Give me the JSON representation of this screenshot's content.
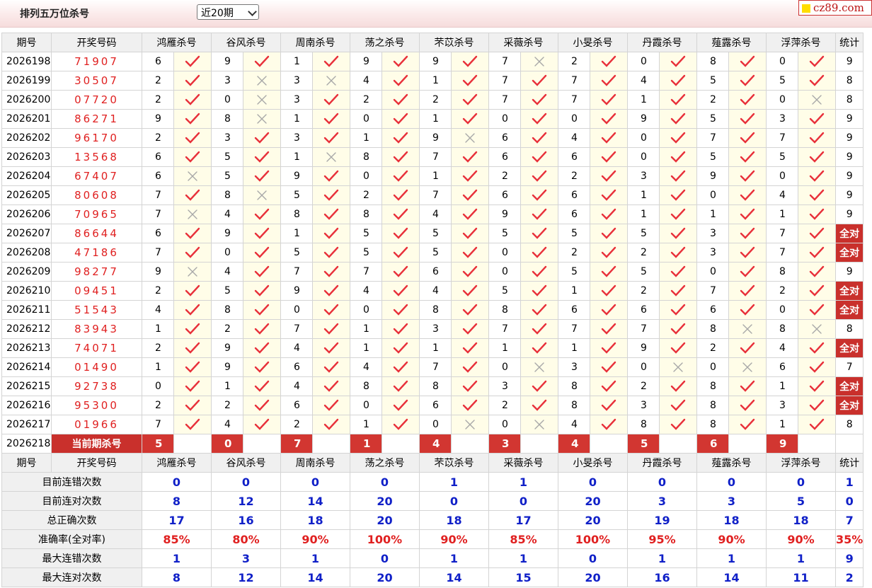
{
  "page_title": "排列五万位杀号",
  "period_select": {
    "value": "近20期"
  },
  "logo_text": "cz89.com",
  "headers": [
    "期号",
    "开奖号码",
    "鸿雁杀号",
    "谷风杀号",
    "周南杀号",
    "荡之杀号",
    "芣苡杀号",
    "采薇杀号",
    "小旻杀号",
    "丹霞杀号",
    "薤露杀号",
    "浮萍杀号",
    "统计"
  ],
  "rows": [
    {
      "issue": "2026198",
      "draw": "71907",
      "kills": [
        6,
        9,
        1,
        9,
        9,
        7,
        2,
        0,
        8,
        0
      ],
      "ok": [
        1,
        1,
        1,
        1,
        1,
        0,
        1,
        1,
        1,
        1
      ],
      "stat": "9"
    },
    {
      "issue": "2026199",
      "draw": "30507",
      "kills": [
        2,
        3,
        3,
        4,
        1,
        7,
        7,
        4,
        5,
        5
      ],
      "ok": [
        1,
        0,
        0,
        1,
        1,
        1,
        1,
        1,
        1,
        1
      ],
      "stat": "8"
    },
    {
      "issue": "2026200",
      "draw": "07720",
      "kills": [
        2,
        0,
        3,
        2,
        2,
        7,
        7,
        1,
        2,
        0
      ],
      "ok": [
        1,
        0,
        1,
        1,
        1,
        1,
        1,
        1,
        1,
        0
      ],
      "stat": "8"
    },
    {
      "issue": "2026201",
      "draw": "86271",
      "kills": [
        9,
        8,
        1,
        0,
        1,
        0,
        0,
        9,
        5,
        3
      ],
      "ok": [
        1,
        0,
        1,
        1,
        1,
        1,
        1,
        1,
        1,
        1
      ],
      "stat": "9"
    },
    {
      "issue": "2026202",
      "draw": "96170",
      "kills": [
        2,
        3,
        3,
        1,
        9,
        6,
        4,
        0,
        7,
        7
      ],
      "ok": [
        1,
        1,
        1,
        1,
        0,
        1,
        1,
        1,
        1,
        1
      ],
      "stat": "9"
    },
    {
      "issue": "2026203",
      "draw": "13568",
      "kills": [
        6,
        5,
        1,
        8,
        7,
        6,
        6,
        0,
        5,
        5
      ],
      "ok": [
        1,
        1,
        0,
        1,
        1,
        1,
        1,
        1,
        1,
        1
      ],
      "stat": "9"
    },
    {
      "issue": "2026204",
      "draw": "67407",
      "kills": [
        6,
        5,
        9,
        0,
        1,
        2,
        2,
        3,
        9,
        0
      ],
      "ok": [
        0,
        1,
        1,
        1,
        1,
        1,
        1,
        1,
        1,
        1
      ],
      "stat": "9"
    },
    {
      "issue": "2026205",
      "draw": "80608",
      "kills": [
        7,
        8,
        5,
        2,
        7,
        6,
        6,
        1,
        0,
        4
      ],
      "ok": [
        1,
        0,
        1,
        1,
        1,
        1,
        1,
        1,
        1,
        1
      ],
      "stat": "9"
    },
    {
      "issue": "2026206",
      "draw": "70965",
      "kills": [
        7,
        4,
        8,
        8,
        4,
        9,
        6,
        1,
        1,
        1
      ],
      "ok": [
        0,
        1,
        1,
        1,
        1,
        1,
        1,
        1,
        1,
        1
      ],
      "stat": "9"
    },
    {
      "issue": "2026207",
      "draw": "86644",
      "kills": [
        6,
        9,
        1,
        5,
        5,
        5,
        5,
        5,
        3,
        7
      ],
      "ok": [
        1,
        1,
        1,
        1,
        1,
        1,
        1,
        1,
        1,
        1
      ],
      "stat": "全对"
    },
    {
      "issue": "2026208",
      "draw": "47186",
      "kills": [
        7,
        0,
        5,
        5,
        5,
        0,
        2,
        2,
        3,
        7
      ],
      "ok": [
        1,
        1,
        1,
        1,
        1,
        1,
        1,
        1,
        1,
        1
      ],
      "stat": "全对"
    },
    {
      "issue": "2026209",
      "draw": "98277",
      "kills": [
        9,
        4,
        7,
        7,
        6,
        0,
        5,
        5,
        0,
        8
      ],
      "ok": [
        0,
        1,
        1,
        1,
        1,
        1,
        1,
        1,
        1,
        1
      ],
      "stat": "9"
    },
    {
      "issue": "2026210",
      "draw": "09451",
      "kills": [
        2,
        5,
        9,
        4,
        4,
        5,
        1,
        2,
        7,
        2
      ],
      "ok": [
        1,
        1,
        1,
        1,
        1,
        1,
        1,
        1,
        1,
        1
      ],
      "stat": "全对"
    },
    {
      "issue": "2026211",
      "draw": "51543",
      "kills": [
        4,
        8,
        0,
        0,
        8,
        8,
        6,
        6,
        6,
        0
      ],
      "ok": [
        1,
        1,
        1,
        1,
        1,
        1,
        1,
        1,
        1,
        1
      ],
      "stat": "全对"
    },
    {
      "issue": "2026212",
      "draw": "83943",
      "kills": [
        1,
        2,
        7,
        1,
        3,
        7,
        7,
        7,
        8,
        8
      ],
      "ok": [
        1,
        1,
        1,
        1,
        1,
        1,
        1,
        1,
        0,
        0
      ],
      "stat": "8"
    },
    {
      "issue": "2026213",
      "draw": "74071",
      "kills": [
        2,
        9,
        4,
        1,
        1,
        1,
        1,
        9,
        2,
        4
      ],
      "ok": [
        1,
        1,
        1,
        1,
        1,
        1,
        1,
        1,
        1,
        1
      ],
      "stat": "全对"
    },
    {
      "issue": "2026214",
      "draw": "01490",
      "kills": [
        1,
        9,
        6,
        4,
        7,
        0,
        3,
        0,
        0,
        6
      ],
      "ok": [
        1,
        1,
        1,
        1,
        1,
        0,
        1,
        0,
        0,
        1
      ],
      "stat": "7"
    },
    {
      "issue": "2026215",
      "draw": "92738",
      "kills": [
        0,
        1,
        4,
        8,
        8,
        3,
        8,
        2,
        8,
        1
      ],
      "ok": [
        1,
        1,
        1,
        1,
        1,
        1,
        1,
        1,
        1,
        1
      ],
      "stat": "全对"
    },
    {
      "issue": "2026216",
      "draw": "95300",
      "kills": [
        2,
        2,
        6,
        0,
        6,
        2,
        8,
        3,
        8,
        3
      ],
      "ok": [
        1,
        1,
        1,
        1,
        1,
        1,
        1,
        1,
        1,
        1
      ],
      "stat": "全对"
    },
    {
      "issue": "2026217",
      "draw": "01966",
      "kills": [
        7,
        4,
        2,
        1,
        0,
        0,
        4,
        8,
        8,
        1
      ],
      "ok": [
        1,
        1,
        1,
        1,
        0,
        0,
        1,
        1,
        1,
        1
      ],
      "stat": "8"
    }
  ],
  "current": {
    "issue": "2026218",
    "label": "当前期杀号",
    "kills": [
      "5",
      "0",
      "7",
      "1",
      "4",
      "3",
      "4",
      "5",
      "6",
      "9"
    ]
  },
  "summary": [
    {
      "label": "目前连错次数",
      "values": [
        "0",
        "0",
        "0",
        "0",
        "1",
        "1",
        "0",
        "0",
        "0",
        "0"
      ],
      "stat": "1",
      "color": "blue"
    },
    {
      "label": "目前连对次数",
      "values": [
        "8",
        "12",
        "14",
        "20",
        "0",
        "0",
        "20",
        "3",
        "3",
        "5"
      ],
      "stat": "0",
      "color": "blue"
    },
    {
      "label": "总正确次数",
      "values": [
        "17",
        "16",
        "18",
        "20",
        "18",
        "17",
        "20",
        "19",
        "18",
        "18"
      ],
      "stat": "7",
      "color": "blue"
    },
    {
      "label": "准确率(全对率)",
      "values": [
        "85%",
        "80%",
        "90%",
        "100%",
        "90%",
        "85%",
        "100%",
        "95%",
        "90%",
        "90%"
      ],
      "stat": "35%",
      "color": "red"
    },
    {
      "label": "最大连错次数",
      "values": [
        "1",
        "3",
        "1",
        "0",
        "1",
        "1",
        "0",
        "1",
        "1",
        "1"
      ],
      "stat": "9",
      "color": "blue"
    },
    {
      "label": "最大连对次数",
      "values": [
        "8",
        "12",
        "14",
        "20",
        "14",
        "15",
        "20",
        "16",
        "14",
        "11"
      ],
      "stat": "2",
      "color": "blue"
    }
  ]
}
